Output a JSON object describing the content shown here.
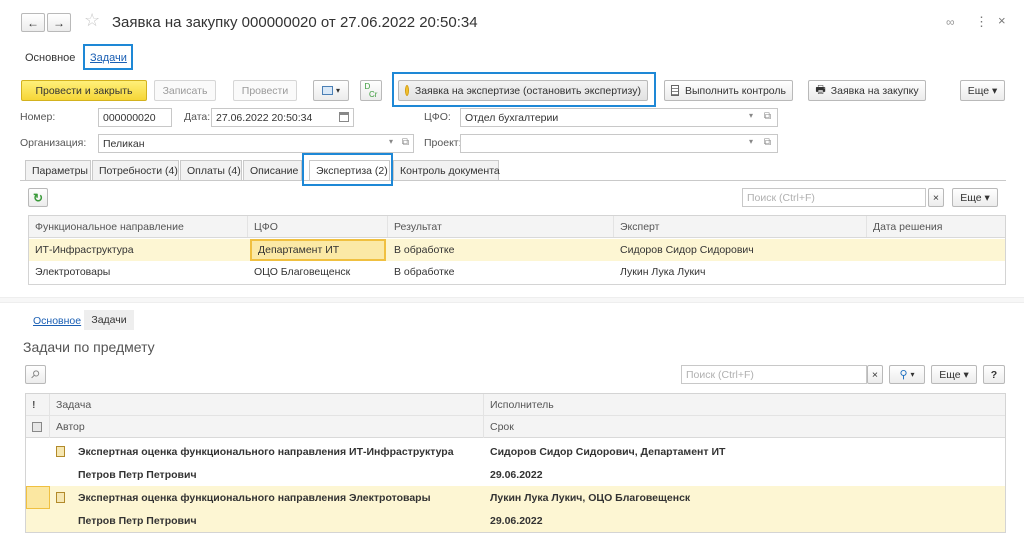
{
  "window": {
    "title": "Заявка на закупку 000000020 от 27.06.2022 20:50:34",
    "star": "☆",
    "link_icon": "🔗",
    "more_icon": "⋮",
    "close_icon": "×"
  },
  "top_tabs": {
    "main": "Основное",
    "tasks": "Задачи"
  },
  "toolbar": {
    "post_close": "Провести и закрыть",
    "save": "Записать",
    "post": "Провести",
    "expertise": "Заявка на экспертизе (остановить экспертизу)",
    "control": "Выполнить контроль",
    "purchase_request": "Заявка на закупку",
    "more": "Еще ▾"
  },
  "form": {
    "number_label": "Номер:",
    "number_value": "000000020",
    "date_label": "Дата:",
    "date_value": "27.06.2022 20:50:34",
    "cfo_label": "ЦФО:",
    "cfo_value": "Отдел бухгалтерии",
    "org_label": "Организация:",
    "org_value": "Пеликан",
    "project_label": "Проект:",
    "project_value": ""
  },
  "inner_tabs": [
    "Параметры",
    "Потребности (4)",
    "Оплаты (4)",
    "Описание",
    "Экспертиза (2)",
    "Контроль документа"
  ],
  "expertise": {
    "search_placeholder": "Поиск (Ctrl+F)",
    "clear": "×",
    "more": "Еще ▾",
    "headers": [
      "Функциональное направление",
      "ЦФО",
      "Результат",
      "Эксперт",
      "Дата решения"
    ],
    "rows": [
      [
        "ИТ-Инфраструктура",
        "Департамент ИТ",
        "В обработке",
        "Сидоров Сидор Сидорович",
        ""
      ],
      [
        "Электротовары",
        "ОЦО Благовещенск",
        "В обработке",
        "Лукин Лука Лукич",
        ""
      ]
    ]
  },
  "tasks_panel": {
    "tab_main": "Основное",
    "tab_tasks": "Задачи",
    "heading": "Задачи по предмету",
    "search_placeholder": "Поиск (Ctrl+F)",
    "clear": "×",
    "search_btn": "🔍 ▾",
    "more": "Еще ▾",
    "help": "?",
    "header_flag": "!",
    "header_task": "Задача",
    "header_performer": "Исполнитель",
    "header_author": "Автор",
    "header_deadline": "Срок",
    "rows": [
      {
        "task": "Экспертная оценка функционального направления ИТ-Инфраструктура",
        "performer": "Сидоров Сидор Сидорович, Департамент ИТ",
        "author": "Петров Петр Петрович",
        "deadline": "29.06.2022"
      },
      {
        "task": "Экспертная оценка функционального направления Электротовары",
        "performer": "Лукин Лука Лукич, ОЦО Благовещенск",
        "author": "Петров Петр Петрович",
        "deadline": "29.06.2022"
      }
    ]
  },
  "colors": {
    "highlight_blue": "#1e88d6",
    "selected_row": "#fdf6d3",
    "yellow_button": "#f6d637"
  }
}
